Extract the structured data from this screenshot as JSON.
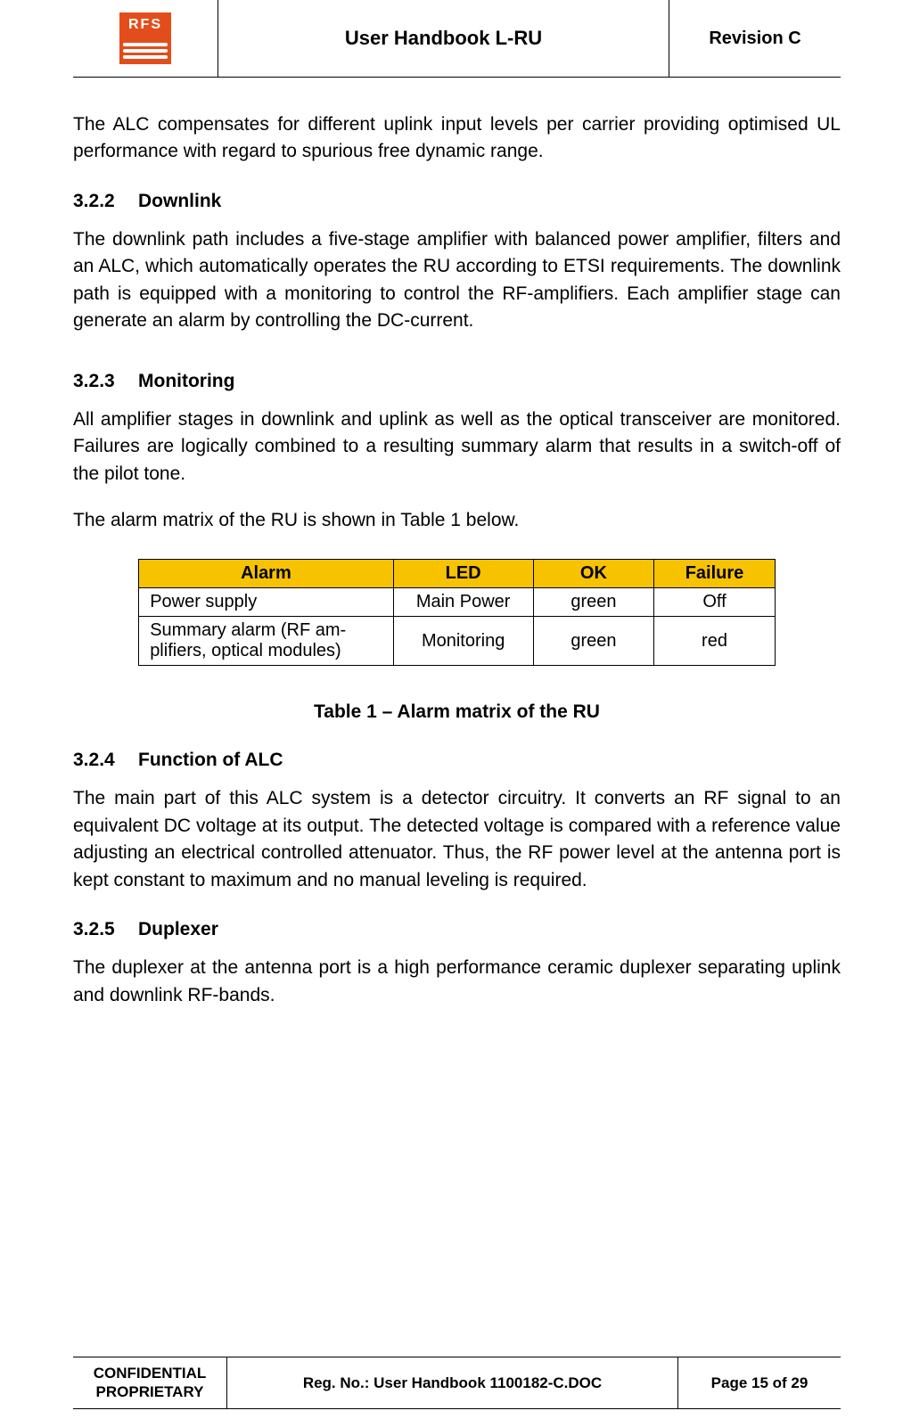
{
  "logo": {
    "text": "RFS"
  },
  "header": {
    "title": "User Handbook L-RU",
    "revision": "Revision C"
  },
  "intro_para": "The ALC compensates for different uplink input levels per carrier providing optimised UL performance with regard to spurious free dynamic range.",
  "s322": {
    "num": "3.2.2",
    "title": "Downlink",
    "para": "The downlink path includes a five-stage amplifier with balanced power amplifier, filters and an ALC, which automatically operates the RU according to ETSI requirements. The downlink path is equipped with a monitoring to control the RF-amplifiers. Each amplifier stage can generate an alarm by controlling the DC-current."
  },
  "s323": {
    "num": "3.2.3",
    "title": "Monitoring",
    "para1": "All amplifier stages in downlink and uplink as well as the optical transceiver are monitored. Failures are logically combined to a resulting summary alarm that results in a switch-off of the pilot tone.",
    "para2": "The alarm matrix of the RU is shown in Table 1 below."
  },
  "alarm_table": {
    "headers": [
      "Alarm",
      "LED",
      "OK",
      "Failure"
    ],
    "rows": [
      {
        "alarm": "Power supply",
        "led": "Main Power",
        "ok": "green",
        "failure": "Off"
      },
      {
        "alarm": "Summary alarm (RF am-plifiers, optical modules)",
        "led": "Monitoring",
        "ok": "green",
        "failure": "red"
      }
    ],
    "caption": "Table 1 – Alarm matrix of the RU"
  },
  "s324": {
    "num": "3.2.4",
    "title": "Function of ALC",
    "para": "The main part of this ALC system is a detector circuitry. It converts an RF signal to an equivalent DC voltage at its output. The detected voltage is compared with a reference value adjusting an electrical controlled attenuator. Thus, the RF power level at the antenna port is kept constant to maximum and no manual leveling is required."
  },
  "s325": {
    "num": "3.2.5",
    "title": "Duplexer",
    "para": "The duplexer at the antenna port is a high performance ceramic duplexer separating uplink and downlink RF-bands."
  },
  "footer": {
    "confidential_l1": "CONFIDENTIAL",
    "confidential_l2": "PROPRIETARY",
    "reg": "Reg. No.: User Handbook 1100182-C.DOC",
    "page": "Page 15 of 29"
  }
}
